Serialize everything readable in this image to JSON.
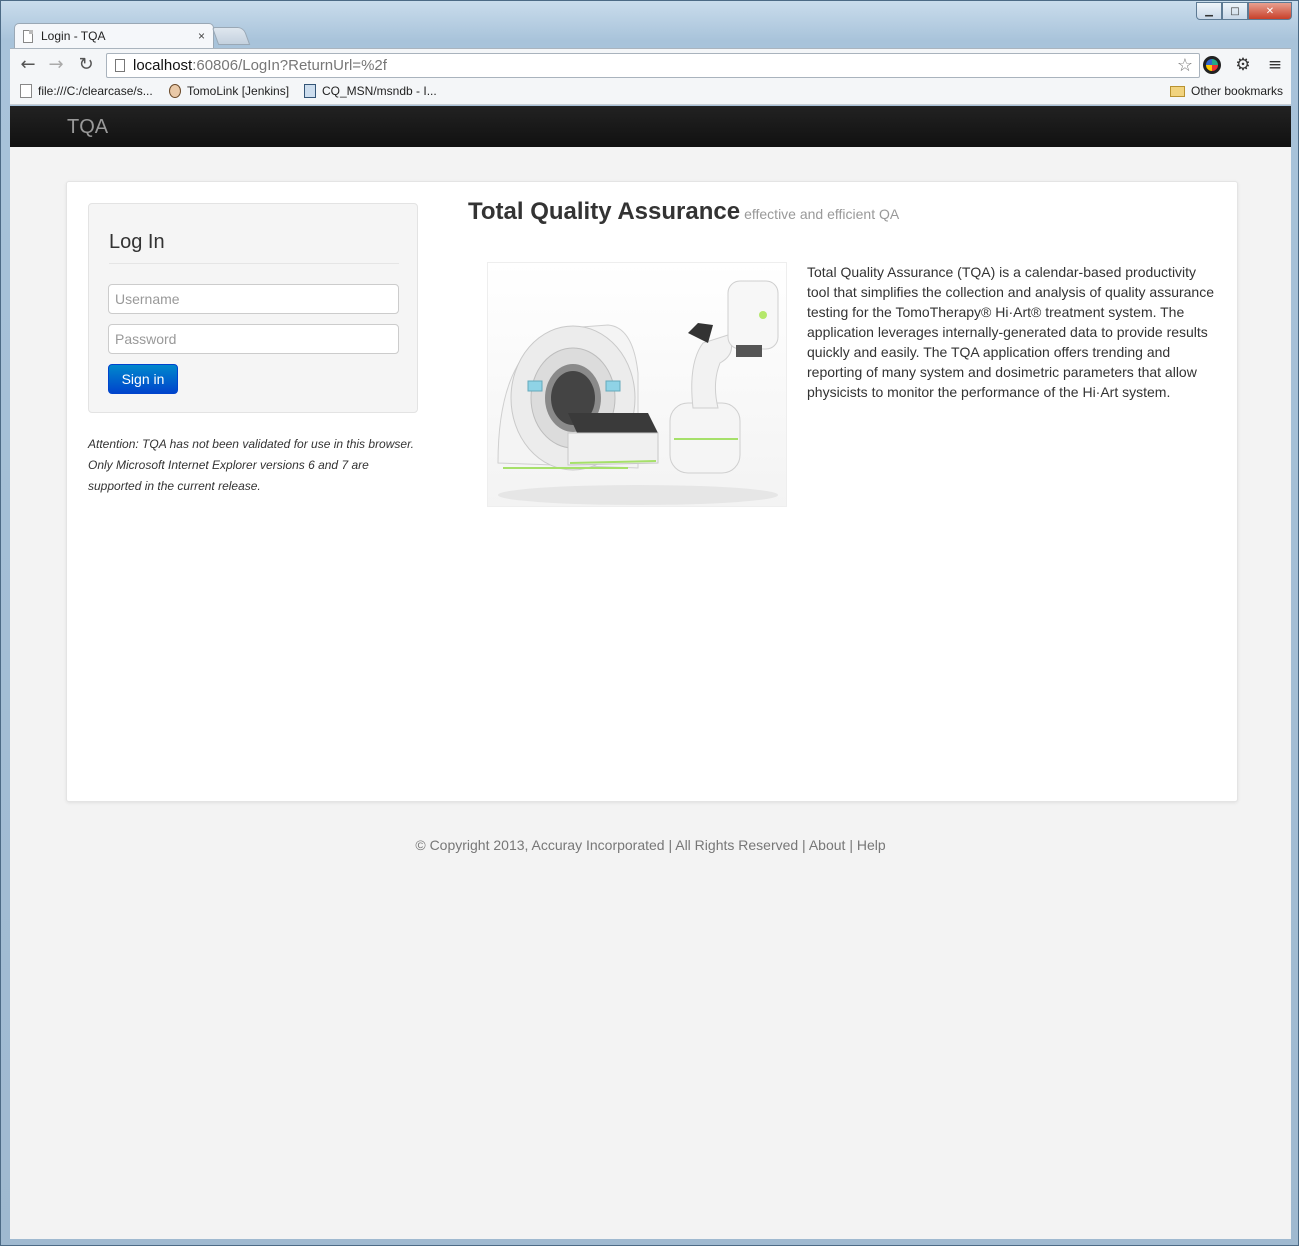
{
  "browser": {
    "tab_title": "Login - TQA",
    "tab_close": "×",
    "url_host": "localhost",
    "url_rest": ":60806/LogIn?ReturnUrl=%2f",
    "bookmarks": [
      {
        "label": "file:///C:/clearcase/s..."
      },
      {
        "label": "TomoLink [Jenkins]"
      },
      {
        "label": "CQ_MSN/msndb - I..."
      }
    ],
    "other_bookmarks": "Other bookmarks"
  },
  "app": {
    "brand": "TQA"
  },
  "login": {
    "title": "Log In",
    "username_placeholder": "Username",
    "password_placeholder": "Password",
    "signin_label": "Sign in",
    "attention": "Attention: TQA has not been validated for use in this browser. Only Microsoft Internet Explorer versions 6 and 7 are supported in the current release."
  },
  "hero": {
    "title": "Total Quality Assurance",
    "subtitle": "effective and efficient QA",
    "description": "Total Quality Assurance (TQA) is a calendar-based productivity tool that simplifies the collection and analysis of quality assurance testing for the TomoTherapy® Hi·Art® treatment system. The application leverages internally-generated data to provide results quickly and easily. The TQA application offers trending and reporting of many system and dosimetric parameters that allow physicists to monitor the performance of the Hi·Art system."
  },
  "footer": {
    "copyright": "© Copyright 2013, Accuray Incorporated | All Rights Reserved |",
    "about": "About",
    "separator": "|",
    "help": "Help"
  },
  "colors": {
    "navbar": "#1b1b1b",
    "button_primary": "#0066cc",
    "page_background": "#f3f3f3"
  }
}
